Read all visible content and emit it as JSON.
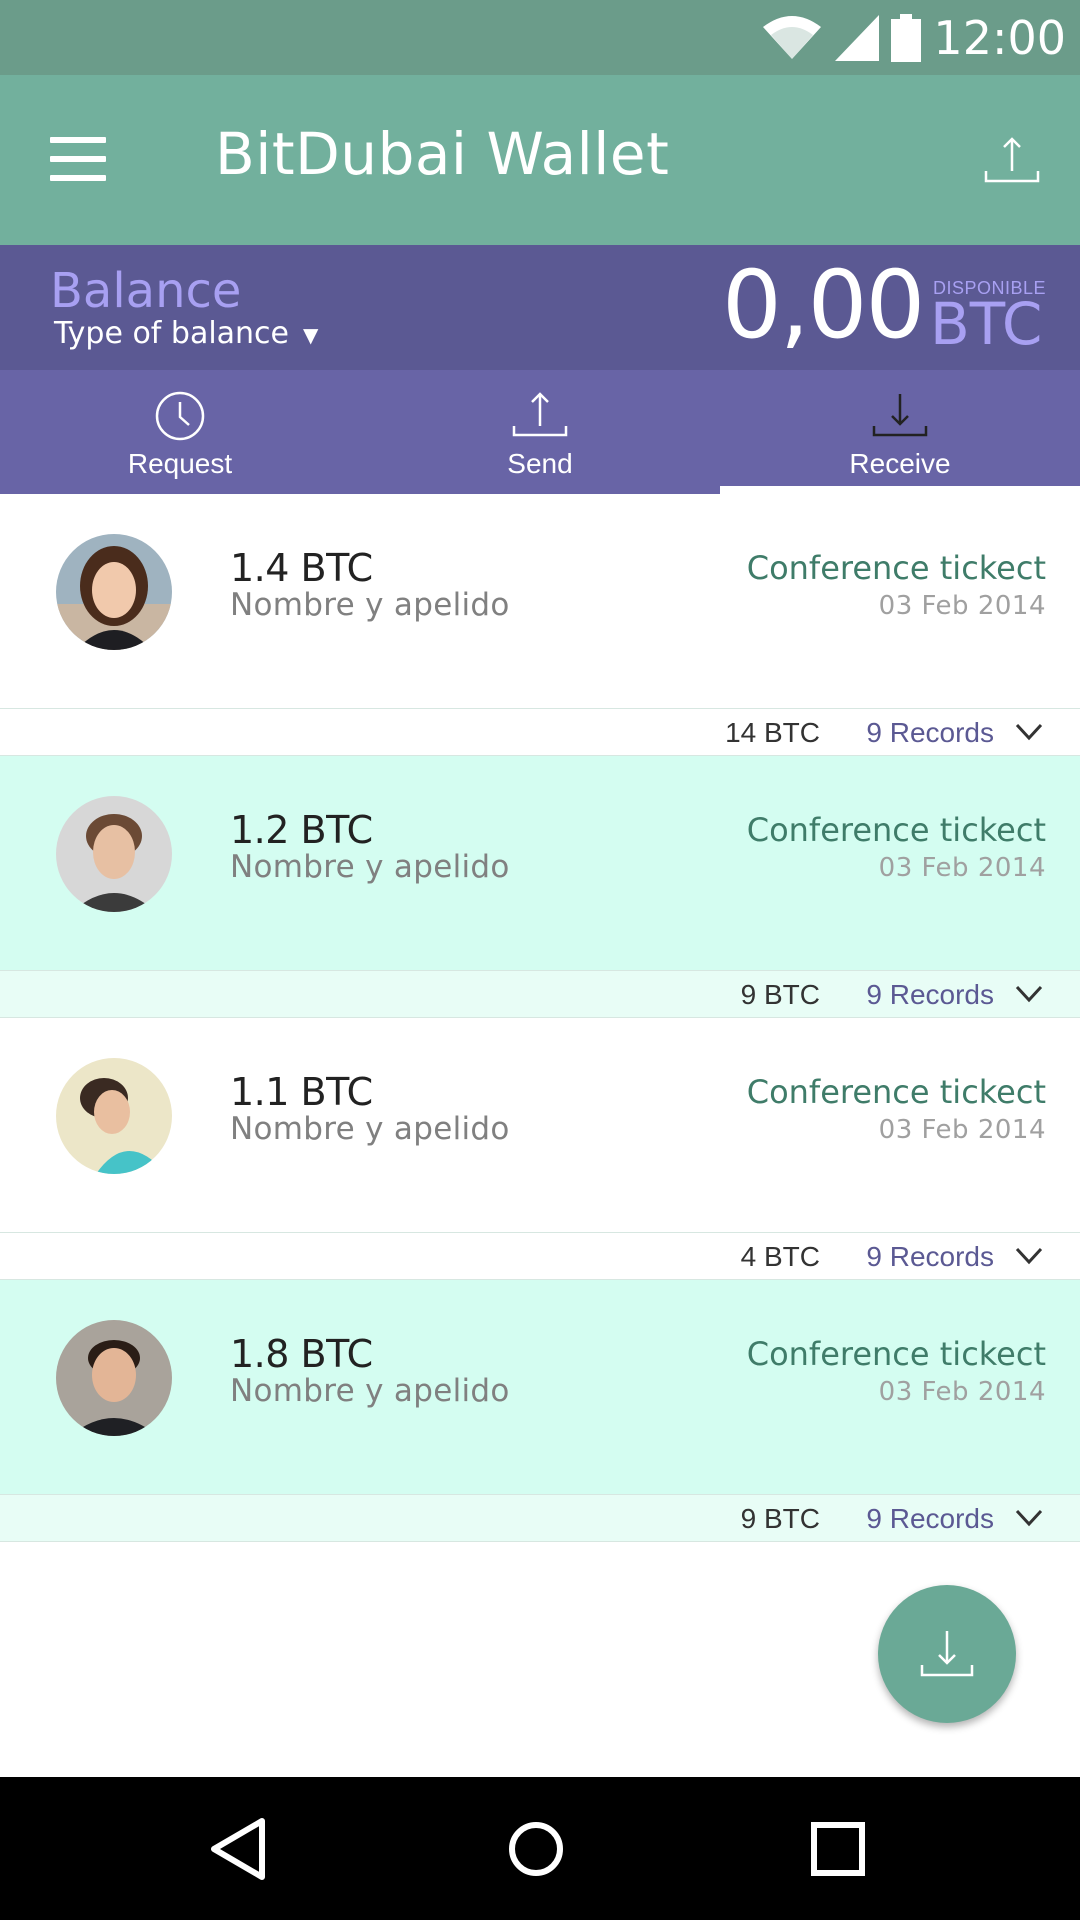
{
  "status_bar": {
    "time": "12:00"
  },
  "app_bar": {
    "title": "BitDubai Wallet"
  },
  "balance": {
    "label": "Balance",
    "type_label": "Type of balance",
    "amount": "0,00",
    "availability": "DISPONIBLE",
    "currency": "BTC"
  },
  "tabs": [
    {
      "label": "Request",
      "icon": "clock-icon"
    },
    {
      "label": "Send",
      "icon": "upload-icon"
    },
    {
      "label": "Receive",
      "icon": "download-icon",
      "active": true
    }
  ],
  "transactions": [
    {
      "amount": "1.4 BTC",
      "name": "Nombre y apelido",
      "concept": "Conference tickect",
      "date": "03 Feb 2014",
      "total": "14 BTC",
      "records": "9 Records"
    },
    {
      "amount": "1.2 BTC",
      "name": "Nombre y apelido",
      "concept": "Conference tickect",
      "date": "03 Feb 2014",
      "total": "9 BTC",
      "records": "9 Records"
    },
    {
      "amount": "1.1 BTC",
      "name": "Nombre y apelido",
      "concept": "Conference tickect",
      "date": "03 Feb 2014",
      "total": "4 BTC",
      "records": "9 Records"
    },
    {
      "amount": "1.8 BTC",
      "name": "Nombre y apelido",
      "concept": "Conference tickect",
      "date": "03 Feb 2014",
      "total": "9 BTC",
      "records": "9 Records"
    }
  ],
  "colors": {
    "status_bar": "#6b9c8a",
    "app_bar": "#72b09d",
    "balance_bar": "#5b5993",
    "tabs_bar": "#6864a6",
    "row_alt": "#d4fdf1",
    "concept_text": "#3f7c69",
    "records_text": "#5b5993",
    "fab": "#6aa996"
  }
}
